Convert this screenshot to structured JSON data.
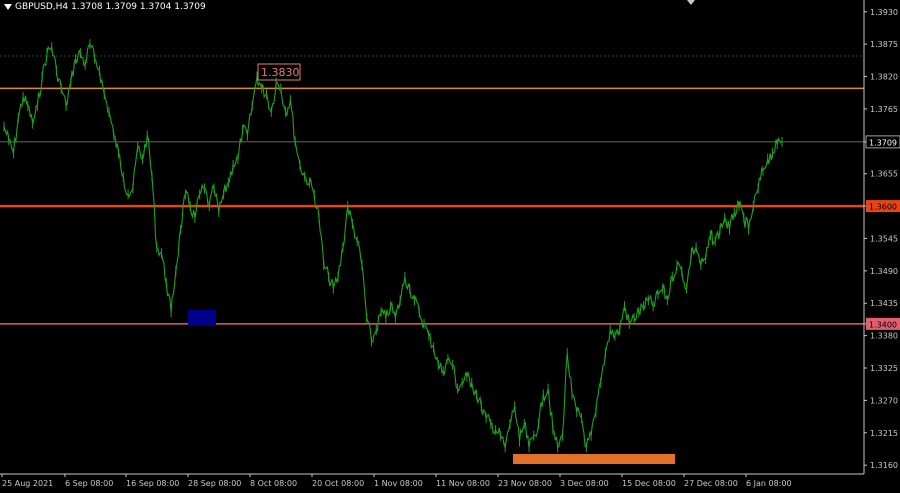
{
  "header": {
    "symbol": "GBPUSD,H4",
    "ohlc": "1.3708 1.3709 1.3704 1.3709"
  },
  "colors": {
    "background": "#000000",
    "price_series": "#1fa31f",
    "axis": "#c8c8c8",
    "level_1_3800": "#d98c2a",
    "level_1_3600": "#e84515",
    "level_1_3400": "#e06070",
    "zone_marker_blue": "#00008b",
    "zone_marker_orange": "#e0702a",
    "callout": "#e0806a"
  },
  "chart_data": {
    "type": "line",
    "symbol": "GBPUSD",
    "timeframe": "H4",
    "y_ticks": [
      "1.3930",
      "1.3875",
      "1.3820",
      "1.3765",
      "1.3709",
      "1.3655",
      "1.3600",
      "1.3545",
      "1.3490",
      "1.3435",
      "1.3400",
      "1.3380",
      "1.3325",
      "1.3270",
      "1.3215",
      "1.3160"
    ],
    "ylim": [
      1.3145,
      1.395
    ],
    "x_ticks": [
      "25 Aug 2021",
      "6 Sep 08:00",
      "16 Sep 08:00",
      "28 Sep 08:00",
      "8 Oct 08:00",
      "20 Oct 08:00",
      "1 Nov 08:00",
      "11 Nov 08:00",
      "23 Nov 08:00",
      "3 Dec 08:00",
      "15 Dec 08:00",
      "27 Dec 08:00",
      "6 Jan 08:00"
    ],
    "series": [
      {
        "name": "GBPUSD,H4",
        "x": [
          0,
          6,
          12,
          18,
          24,
          30,
          36,
          42,
          48,
          54,
          60,
          66,
          72,
          78,
          84,
          90,
          96,
          102,
          108,
          114,
          120,
          126,
          132,
          138,
          144,
          150,
          156,
          162,
          168,
          174,
          180,
          186,
          192,
          198,
          204,
          210,
          216,
          222,
          228,
          234,
          240,
          246,
          252,
          258,
          264,
          270,
          276,
          282,
          288,
          294,
          300,
          306,
          312,
          318,
          324,
          330,
          336,
          342,
          348,
          354,
          360,
          366,
          372,
          378,
          384,
          390,
          396,
          402,
          408,
          414,
          420,
          426,
          432,
          438,
          444,
          450,
          456,
          462,
          468,
          474,
          480,
          486,
          492,
          498,
          504,
          510,
          516,
          522,
          528,
          534,
          540,
          546,
          552,
          558,
          564,
          570,
          576,
          582,
          588,
          594,
          600,
          606,
          612,
          618,
          624,
          630,
          636,
          642,
          648,
          654,
          660,
          666,
          672,
          678,
          684,
          690,
          696,
          702,
          708,
          714,
          720,
          726,
          732,
          738,
          744,
          750,
          756,
          762,
          768,
          774,
          780
        ],
        "values": [
          1.3735,
          1.3712,
          1.369,
          1.375,
          1.3785,
          1.377,
          1.374,
          1.377,
          1.382,
          1.386,
          1.387,
          1.383,
          1.38,
          1.377,
          1.381,
          1.385,
          1.386,
          1.384,
          1.3875,
          1.385,
          1.383,
          1.379,
          1.376,
          1.372,
          1.369,
          1.365,
          1.362,
          1.363,
          1.37,
          1.368,
          1.372,
          1.365,
          1.353,
          1.352,
          1.347,
          1.342,
          1.349,
          1.356,
          1.362,
          1.36,
          1.358,
          1.362,
          1.363,
          1.36,
          1.363,
          1.359,
          1.362,
          1.364,
          1.367,
          1.368,
          1.373,
          1.372,
          1.377,
          1.382,
          1.38,
          1.379,
          1.376,
          1.381,
          1.38,
          1.376,
          1.378,
          1.371,
          1.367,
          1.365,
          1.364,
          1.362,
          1.358,
          1.35,
          1.348,
          1.346,
          1.348,
          1.353,
          1.36,
          1.357,
          1.354,
          1.35,
          1.341,
          1.337,
          1.339,
          1.342,
          1.341,
          1.343,
          1.341,
          1.344,
          1.348,
          1.346,
          1.344,
          1.342,
          1.34,
          1.338,
          1.336,
          1.333,
          1.332,
          1.334,
          1.333,
          1.329,
          1.33,
          1.331,
          1.33,
          1.328,
          1.326,
          1.324,
          1.323,
          1.322,
          1.321,
          1.319,
          1.323,
          1.326,
          1.32,
          1.323,
          1.319,
          1.321,
          1.323,
          1.328,
          1.329,
          1.322,
          1.319,
          1.321,
          1.335,
          1.328,
          1.325,
          1.324,
          1.319,
          1.321,
          1.325,
          1.33,
          1.335,
          1.339,
          1.338,
          1.339,
          1.343
        ]
      }
    ],
    "tail": {
      "x": [
        786,
        792,
        798,
        804,
        810,
        816,
        822,
        828,
        834,
        840,
        846,
        852,
        858,
        864,
        870,
        876,
        882,
        888,
        894,
        900,
        906,
        912,
        918,
        924,
        930,
        936,
        942,
        948,
        954,
        960,
        966,
        972,
        978
      ],
      "values": [
        1.34,
        1.341,
        1.342,
        1.343,
        1.344,
        1.343,
        1.345,
        1.346,
        1.344,
        1.348,
        1.35,
        1.349,
        1.346,
        1.352,
        1.353,
        1.35,
        1.351,
        1.355,
        1.354,
        1.356,
        1.358,
        1.356,
        1.359,
        1.36,
        1.358,
        1.356,
        1.36,
        1.363,
        1.366,
        1.368,
        1.369,
        1.3705,
        1.3709
      ]
    },
    "horizontal_levels": [
      {
        "price": 1.38,
        "label": "1.3800",
        "color": "#d98c2a",
        "width": 1.5
      },
      {
        "price": 1.36,
        "label": "1.3600",
        "color": "#e84515",
        "width": 2.5
      },
      {
        "price": 1.34,
        "label": "1.3400",
        "color": "#e06070",
        "width": 1.5
      },
      {
        "price": 1.3709,
        "label": "1.3709",
        "color": "#8a8a8a",
        "width": 0.7
      }
    ],
    "annotations": [
      {
        "text": "1.3830",
        "price": 1.383
      }
    ],
    "grid": false
  }
}
